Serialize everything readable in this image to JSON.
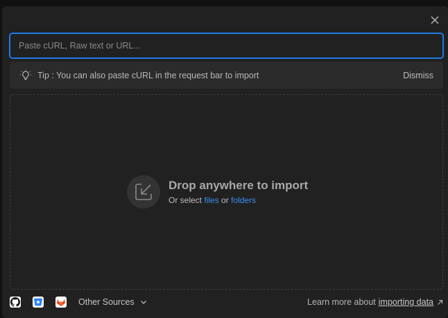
{
  "dialog": {
    "search": {
      "placeholder": "Paste cURL, Raw text or URL..."
    },
    "tip": {
      "text": "Tip : You can also paste cURL in the request bar to import",
      "dismiss_label": "Dismiss"
    },
    "dropzone": {
      "title": "Drop anywhere to import",
      "subtitle_prefix": "Or select",
      "files_link": "files",
      "or_text": "or",
      "folders_link": "folders"
    },
    "footer": {
      "sources": [
        {
          "name": "github-icon",
          "color": "#ffffff"
        },
        {
          "name": "bitbucket-icon",
          "color": "#2684ff"
        },
        {
          "name": "gitlab-icon",
          "color": "#e24329"
        }
      ],
      "other_sources_label": "Other Sources",
      "learn_prefix": "Learn more about",
      "learn_link": "importing data"
    },
    "colors": {
      "accent": "#1e7ae6",
      "link": "#3b8ef0",
      "background": "#212121"
    }
  }
}
